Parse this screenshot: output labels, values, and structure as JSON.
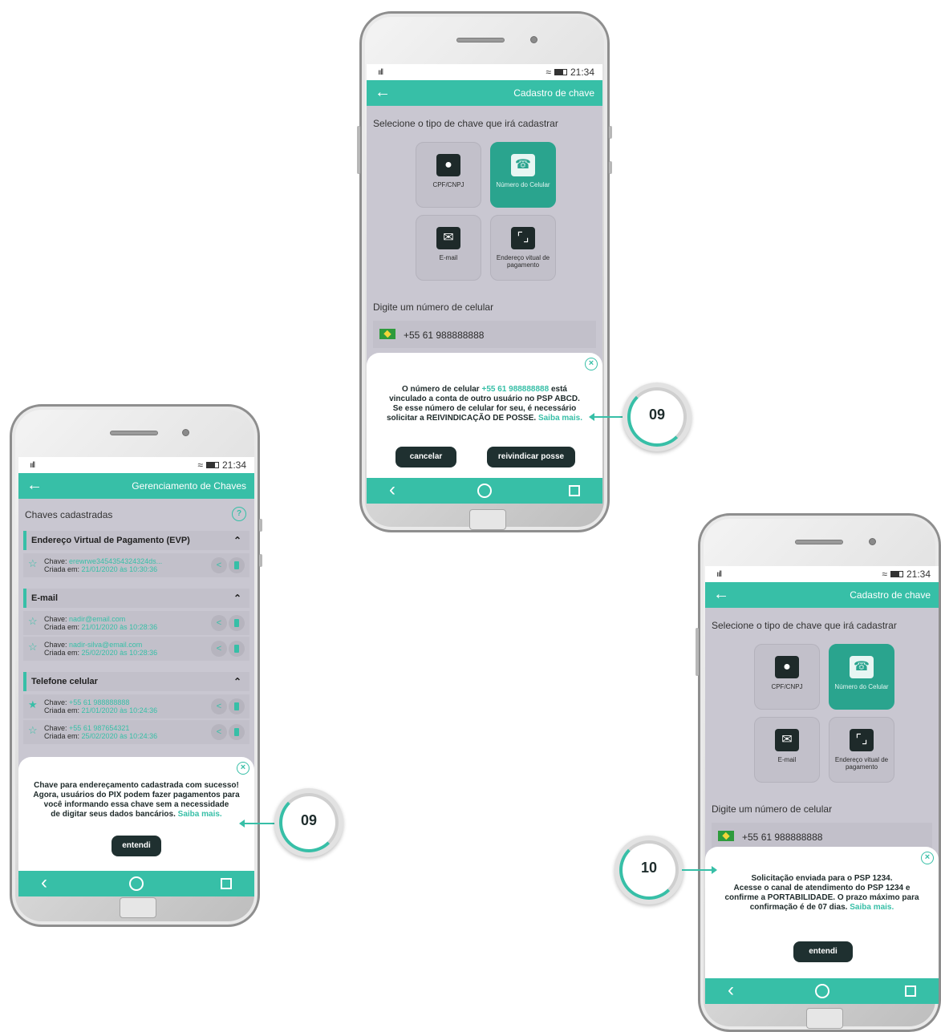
{
  "colors": {
    "accent": "#37bfa7",
    "dark_button": "#1f3030",
    "screen_bg": "#c9c7d1"
  },
  "status": {
    "signal": "ııll",
    "time": "21:34",
    "wifi": "≈"
  },
  "nav": {
    "back": "‹"
  },
  "phone_center": {
    "app_title": "Cadastro de chave",
    "select_label": "Selecione o tipo de chave que irá cadastrar",
    "tiles": [
      {
        "label": "CPF/CNPJ",
        "icon": "person-card-icon"
      },
      {
        "label": "Número do Celular",
        "icon": "phone-contact-icon"
      },
      {
        "label": "E-mail",
        "icon": "email-card-icon"
      },
      {
        "label": "Endereço vitual de pagamento",
        "icon": "frame-icon"
      }
    ],
    "phone_label": "Digite um número de celular",
    "phone_value": "+55 61 988888888",
    "dialog": {
      "line1_pre": "O número de celular ",
      "line1_hl": "+55 61 988888888",
      "line1_post": " está",
      "line2": "vinculado a conta de outro usuário no PSP ABCD.",
      "line3": "Se esse número de celular for seu, é necessário",
      "line4": "solicitar a REIVINDICAÇÃO DE POSSE.",
      "link": "Saiba mais.",
      "cancel": "cancelar",
      "claim": "reivindicar posse"
    },
    "step": "09"
  },
  "phone_left": {
    "app_title": "Gerenciamento de Chaves",
    "list_label": "Chaves cadastradas",
    "help": "?",
    "groups": [
      {
        "title": "Endereço Virtual de Pagamento (EVP)"
      },
      {
        "title": "E-mail"
      },
      {
        "title": "Telefone celular"
      }
    ],
    "rows": [
      {
        "key_label": "Chave:",
        "key": "erewrwe3454354324324ds...",
        "date_label": "Criada em:",
        "date": "21/01/2020 às 10:30:36"
      },
      {
        "key_label": "Chave:",
        "key": "nadir@email.com",
        "date_label": "Criada em:",
        "date": "21/01/2020 às 10:28:36"
      },
      {
        "key_label": "Chave:",
        "key": "nadir-silva@email.com",
        "date_label": "Criada em:",
        "date": "25/02/2020 às 10:28:36"
      },
      {
        "key_label": "Chave:",
        "key": "+55 61 988888888",
        "date_label": "Criada em:",
        "date": "21/01/2020 às 10:24:36"
      },
      {
        "key_label": "Chave:",
        "key": "+55 61 987654321",
        "date_label": "Criada em:",
        "date": "25/02/2020 às 10:24:36"
      }
    ],
    "dialog": {
      "line1": "Chave para endereçamento cadastrada com sucesso!",
      "line2": "Agora, usuários do PIX podem fazer pagamentos para",
      "line3": "você informando essa chave sem a necessidade",
      "line4": "de digitar seus dados bancários.",
      "link": "Saiba mais.",
      "ok": "entendi"
    },
    "step": "09"
  },
  "phone_right": {
    "app_title": "Cadastro de chave",
    "select_label": "Selecione o tipo de chave que irá cadastrar",
    "tiles": [
      {
        "label": "CPF/CNPJ"
      },
      {
        "label": "Número do Celular"
      },
      {
        "label": "E-mail"
      },
      {
        "label": "Endereço vitual de pagamento"
      }
    ],
    "phone_label": "Digite um número de celular",
    "phone_value": "+55 61 988888888",
    "dialog": {
      "line1": "Solicitação enviada para o PSP 1234.",
      "line2": "Acesse o canal de atendimento do PSP 1234 e",
      "line3": "confirme a PORTABILIDADE. O prazo máximo para",
      "line4": "confirmação é de 07 dias.",
      "link": "Saiba mais.",
      "ok": "entendi"
    },
    "step": "10"
  }
}
